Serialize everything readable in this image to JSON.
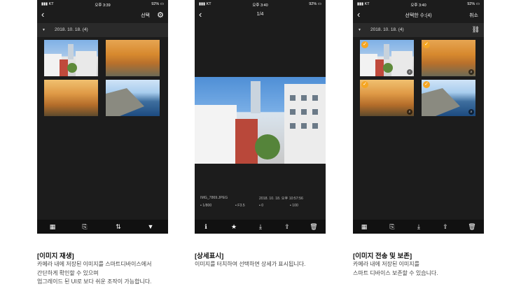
{
  "status": {
    "carrier": "KT",
    "battery": "92%",
    "time1": "오후 3:39",
    "time2": "오후 3:40",
    "time3": "오후 3:40"
  },
  "phone1": {
    "header_action": "선택",
    "date_group": "2018. 10. 18. (4)",
    "toolbar_icons": [
      "grid-icon",
      "import-icon",
      "sort-icon",
      "filter-icon"
    ]
  },
  "phone2": {
    "counter": "1/4",
    "filename": "IMG_7869.JPEG",
    "datetime": "2018. 10. 18. 오후 10:57:56",
    "shutter": "1/800",
    "aperture": "F3.5",
    "exposure": "0",
    "iso": "100",
    "toolbar_icons": [
      "info-icon",
      "star-icon",
      "download-icon",
      "share-icon",
      "trash-icon"
    ]
  },
  "phone3": {
    "title": "선택한 수:(4)",
    "cancel": "취소",
    "date_group": "2018. 10. 18. (4)",
    "toolbar_icons": [
      "grid-icon",
      "import-icon",
      "download-icon",
      "share-icon",
      "trash-icon"
    ]
  },
  "captions": [
    {
      "title": "[이미지 재생]",
      "lines": [
        "카메라 내에 저장된 이미지를 스마트디바이스에서",
        "간단하게 확인할 수 있으며",
        "업그레이드 된 UI로 보다 쉬운 조작이 가능합니다."
      ]
    },
    {
      "title": "[상세표시]",
      "lines": [
        "이미지를 터치하여 선택하면 상세가 표시됩니다."
      ]
    },
    {
      "title": "[이미지 전송 및 보존]",
      "lines": [
        "카메라 내에 저장된 이미지를",
        "스마트 디바이스 보존할 수 있습니다."
      ]
    }
  ],
  "colors": {
    "check": "#f5a623",
    "phone_bg": "#1c1c1c"
  }
}
